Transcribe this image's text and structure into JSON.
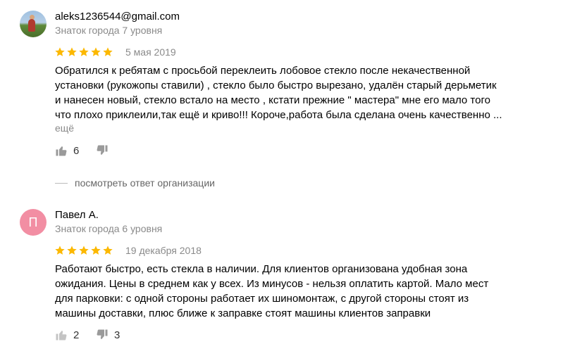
{
  "reviews": [
    {
      "author": "aleks1236544@gmail.com",
      "level": "Знаток города 7 уровня",
      "rating": 5,
      "date": "5 мая 2019",
      "text_lines": [
        "Обратился к ребятам с просьбой переклеить лобовое стекло после некачественной",
        "установки (рукожопы ставили) , стекло было быстро вырезано, удалён старый дерьметик",
        "и нанесен новый, стекло встало на место , кстати прежние \" мастера\" мне его мало того",
        "что плохо приклеили,так ещё и криво!!! Короче,работа была сделана очень качественно ..."
      ],
      "more_label": "ещё",
      "likes": "6",
      "dislikes": "",
      "answer_link": "посмотреть ответ организации"
    },
    {
      "author": "Павел А.",
      "avatar_letter": "П",
      "level": "Знаток города 6 уровня",
      "rating": 5,
      "date": "19 декабря 2018",
      "text_lines": [
        "Работают быстро, есть стекла в наличии. Для клиентов организована удобная зона",
        "ожидания. Цены в среднем как у всех. Из минусов - нельзя оплатить картой. Мало мест",
        "для парковки: с одной стороны работает их шиномонтаж, с другой стороны стоят из",
        "машины доставки, плюс ближе к заправке стоят машины клиентов заправки"
      ],
      "likes": "2",
      "dislikes": "3"
    }
  ],
  "colors": {
    "star": "#fcb800",
    "secondary_text": "#8a8a8a",
    "avatar_letter_bg": "#f28ea3"
  },
  "icons": {
    "like": "thumbs-up-icon",
    "dislike": "thumbs-down-icon",
    "star": "star-icon"
  }
}
